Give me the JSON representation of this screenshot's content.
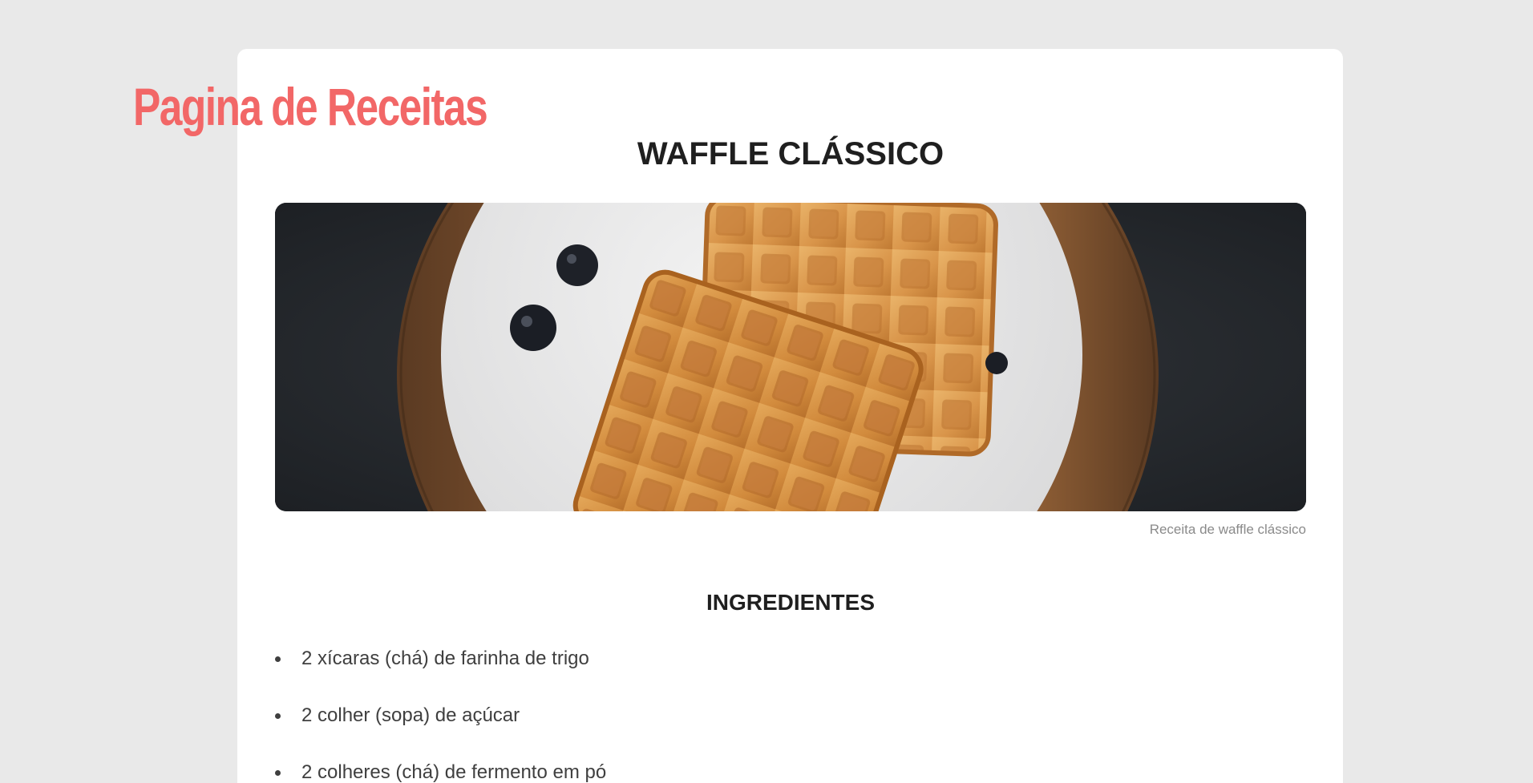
{
  "site": {
    "title": "Pagina de Receitas"
  },
  "recipe": {
    "title": "WAFFLE CLÁSSICO",
    "image_caption": "Receita de waffle clássico",
    "ingredients_heading": "INGREDIENTES",
    "ingredients": [
      "2 xícaras (chá) de farinha de trigo",
      "2 colher (sopa) de açúcar",
      "2 colheres (chá) de fermento em pó"
    ]
  },
  "colors": {
    "brand": "#f26767",
    "background": "#e9e9e9",
    "card": "#ffffff",
    "heading": "#1f1f1f",
    "body_text": "#3f3f3f",
    "caption": "#8a8a8a"
  }
}
